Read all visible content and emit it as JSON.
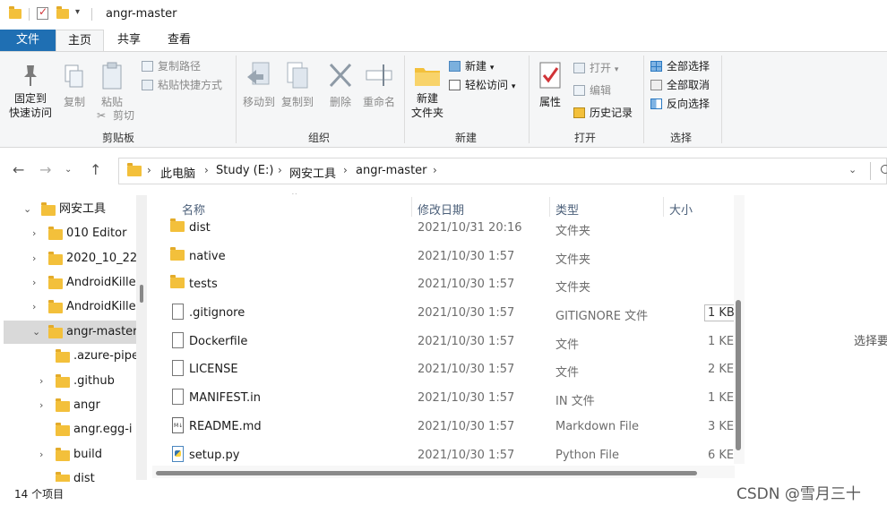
{
  "window": {
    "title": "angr-master"
  },
  "ribbon": {
    "tabs": [
      "文件",
      "主页",
      "共享",
      "查看"
    ],
    "clipboard": {
      "label": "剪贴板",
      "pin": "固定到\n快速访问",
      "pin_line1": "固定到",
      "pin_line2": "快速访问",
      "copy": "复制",
      "paste": "粘贴",
      "copy_path": "复制路径",
      "paste_shortcut": "粘贴快捷方式",
      "cut": "剪切"
    },
    "organize": {
      "label": "组织",
      "move_to": "移动到",
      "copy_to": "复制到",
      "delete": "删除",
      "rename": "重命名"
    },
    "new": {
      "label": "新建",
      "new_item": "新建",
      "easy_access": "轻松访问",
      "new_folder_line1": "新建",
      "new_folder_line2": "文件夹"
    },
    "open": {
      "label": "打开",
      "properties": "属性",
      "open": "打开",
      "edit": "编辑",
      "history": "历史记录"
    },
    "select": {
      "label": "选择",
      "select_all": "全部选择",
      "select_none": "全部取消",
      "invert": "反向选择"
    }
  },
  "address": {
    "crumbs": [
      "此电脑",
      "Study (E:)",
      "网安工具",
      "angr-master"
    ]
  },
  "navpane": {
    "items": [
      {
        "label": "网安工具",
        "chev": "⌄"
      },
      {
        "label": "010 Editor",
        "chev": "›"
      },
      {
        "label": "2020_10_22",
        "chev": "›"
      },
      {
        "label": "AndroidKille",
        "chev": "›"
      },
      {
        "label": "AndroidKille",
        "chev": "›"
      },
      {
        "label": "angr-master",
        "chev": "⌄"
      },
      {
        "label": ".azure-pipe",
        "chev": ""
      },
      {
        "label": ".github",
        "chev": "›"
      },
      {
        "label": "angr",
        "chev": "›"
      },
      {
        "label": "angr.egg-i",
        "chev": ""
      },
      {
        "label": "build",
        "chev": "›"
      },
      {
        "label": "dist",
        "chev": ""
      }
    ]
  },
  "filelist": {
    "columns": {
      "name": "名称",
      "modified": "修改日期",
      "type": "类型",
      "size": "大小"
    },
    "rows": [
      {
        "name": "dist",
        "modified": "2021/10/31 20:16",
        "type": "文件夹",
        "size": "",
        "kind": "folder"
      },
      {
        "name": "native",
        "modified": "2021/10/30 1:57",
        "type": "文件夹",
        "size": "",
        "kind": "folder"
      },
      {
        "name": "tests",
        "modified": "2021/10/30 1:57",
        "type": "文件夹",
        "size": "",
        "kind": "folder"
      },
      {
        "name": ".gitignore",
        "modified": "2021/10/30 1:57",
        "type": "GITIGNORE 文件",
        "size": "1 KB",
        "kind": "file"
      },
      {
        "name": "Dockerfile",
        "modified": "2021/10/30 1:57",
        "type": "文件",
        "size": "1 KE",
        "kind": "file"
      },
      {
        "name": "LICENSE",
        "modified": "2021/10/30 1:57",
        "type": "文件",
        "size": "2 KE",
        "kind": "file"
      },
      {
        "name": "MANIFEST.in",
        "modified": "2021/10/30 1:57",
        "type": "IN 文件",
        "size": "1 KE",
        "kind": "file"
      },
      {
        "name": "README.md",
        "modified": "2021/10/30 1:57",
        "type": "Markdown File",
        "size": "3 KE",
        "kind": "md"
      },
      {
        "name": "setup.py",
        "modified": "2021/10/30 1:57",
        "type": "Python File",
        "size": "6 KE",
        "kind": "py"
      }
    ]
  },
  "preview": {
    "text": "选择要"
  },
  "status": {
    "count": "14 个项目"
  },
  "watermark": "CSDN @雪月三十",
  "colors": {
    "accent": "#1f6fb3",
    "folder": "#f3c03b",
    "selected": "#d9d9d9"
  }
}
